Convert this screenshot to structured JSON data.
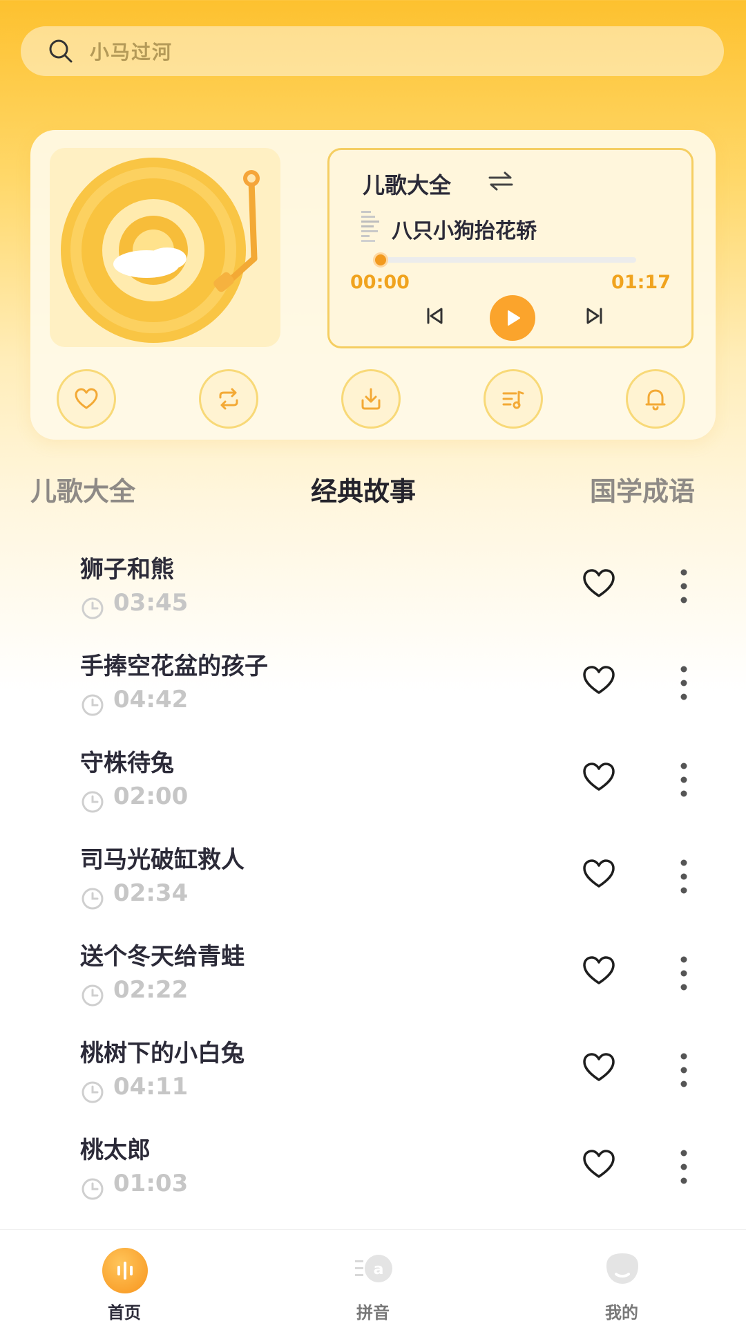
{
  "search": {
    "placeholder": "小马过河",
    "icon": "search-icon"
  },
  "player": {
    "playlist_title": "儿歌大全",
    "song_title": "八只小狗抬花轿",
    "current_time": "00:00",
    "total_time": "01:17",
    "progress": 0.0,
    "accent": "#F29A1F",
    "actions": [
      {
        "name": "favorite",
        "icon": "heart-icon"
      },
      {
        "name": "repeat",
        "icon": "repeat-icon"
      },
      {
        "name": "download",
        "icon": "download-icon"
      },
      {
        "name": "playlist",
        "icon": "playlist-icon"
      },
      {
        "name": "alarm",
        "icon": "bell-icon"
      }
    ]
  },
  "tabs": [
    {
      "label": "儿歌大全",
      "active": false
    },
    {
      "label": "经典故事",
      "active": true
    },
    {
      "label": "国学成语",
      "active": false
    }
  ],
  "list": [
    {
      "title": "狮子和熊",
      "duration": "03:45"
    },
    {
      "title": "手捧空花盆的孩子",
      "duration": "04:42"
    },
    {
      "title": "守株待兔",
      "duration": "02:00"
    },
    {
      "title": "司马光破缸救人",
      "duration": "02:34"
    },
    {
      "title": "送个冬天给青蛙",
      "duration": "02:22"
    },
    {
      "title": "桃树下的小白兔",
      "duration": "04:11"
    },
    {
      "title": "桃太郎",
      "duration": "01:03"
    }
  ],
  "bottom_nav": [
    {
      "label": "首页",
      "active": true,
      "icon": "home-sound-icon"
    },
    {
      "label": "拼音",
      "active": false,
      "icon": "pinyin-icon"
    },
    {
      "label": "我的",
      "active": false,
      "icon": "profile-icon"
    }
  ]
}
